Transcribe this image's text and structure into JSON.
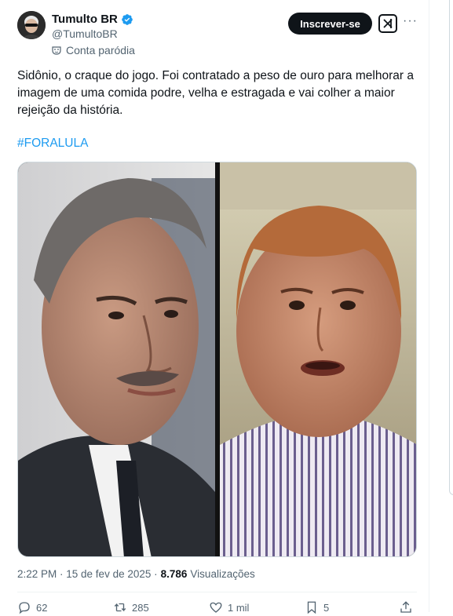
{
  "author": {
    "name": "Tumulto BR",
    "handle": "@TumultoBR",
    "label": "Conta paródia"
  },
  "header": {
    "subscribe_label": "Inscrever-se",
    "more_label": "···"
  },
  "post": {
    "text": "Sidônio, o craque do jogo. Foi contratado a peso de ouro para melhorar a imagem de uma comida podre, velha e estragada e vai colher a maior rejeição da história.",
    "hashtag": "#FORALULA",
    "time": "2:22 PM · 15 de fev de 2025 ·",
    "views_count": "8.786",
    "views_label": "Visualizações"
  },
  "actions": {
    "replies": "62",
    "reposts": "285",
    "likes": "1 mil",
    "bookmarks": "5"
  },
  "colors": {
    "link": "#1d9bf0",
    "verified": "#1d9bf0",
    "text_secondary": "#536471"
  },
  "icons": [
    "verified-icon",
    "mask-icon",
    "grok-icon",
    "more-icon",
    "reply-icon",
    "repost-icon",
    "like-icon",
    "bookmark-icon",
    "share-icon"
  ]
}
